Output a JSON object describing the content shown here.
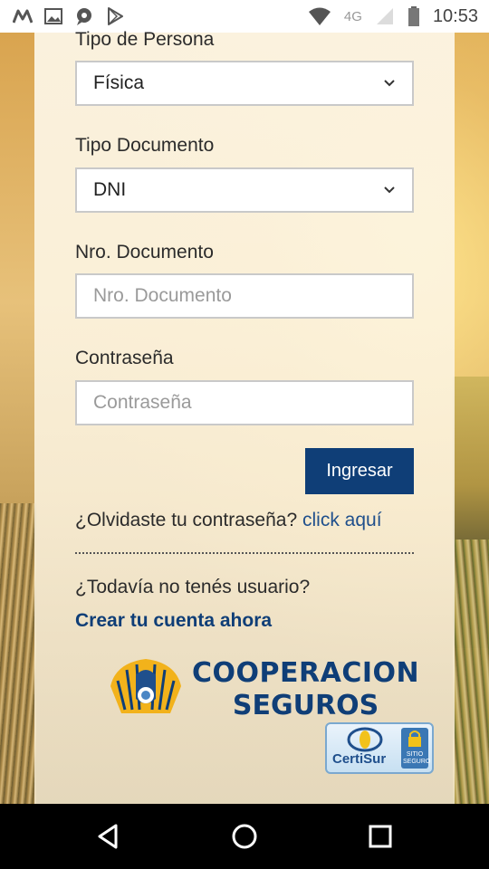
{
  "status_bar": {
    "time": "10:53",
    "network": "4G",
    "icons": [
      "m-icon",
      "image-icon",
      "chat-icon",
      "play-store-icon",
      "wifi-icon",
      "signal-icon",
      "battery-icon"
    ]
  },
  "form": {
    "tipo_persona": {
      "label": "Tipo de Persona",
      "value": "Física"
    },
    "tipo_documento": {
      "label": "Tipo Documento",
      "value": "DNI"
    },
    "nro_documento": {
      "label": "Nro. Documento",
      "placeholder": "Nro. Documento",
      "value": ""
    },
    "password": {
      "label": "Contraseña",
      "placeholder": "Contraseña",
      "value": ""
    },
    "submit_label": "Ingresar"
  },
  "forgot": {
    "text": "¿Olvidaste tu contraseña?",
    "link": "click aquí"
  },
  "signup": {
    "text": "¿Todavía no tenés usuario?",
    "link": "Crear tu cuenta ahora"
  },
  "brand": {
    "line1": "COOPERACION",
    "line2": "SEGUROS",
    "badge": "CertiSur",
    "badge_sub": "SITIO SEGURO"
  },
  "colors": {
    "primary": "#0f3e77",
    "link": "#1f4f8c"
  },
  "nav_bar": {
    "icons": [
      "back-icon",
      "home-icon",
      "recents-icon"
    ]
  }
}
